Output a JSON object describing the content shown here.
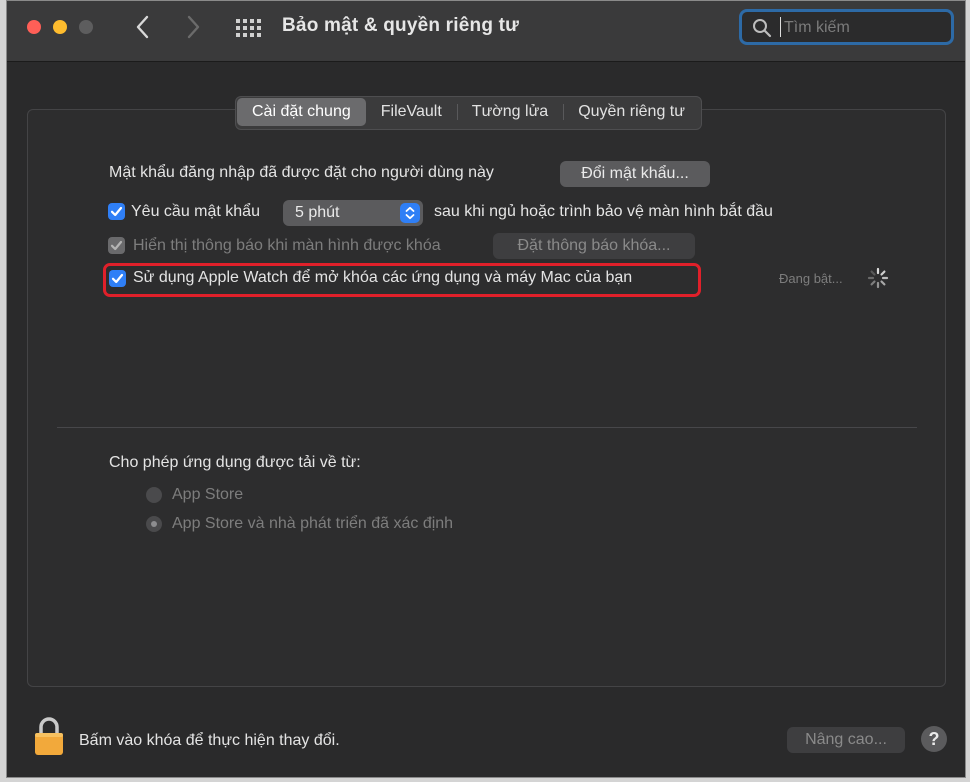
{
  "window": {
    "title": "Bảo mật & quyền riêng tư",
    "search_placeholder": "Tìm kiếm"
  },
  "tabs": [
    {
      "label": "Cài đặt chung",
      "active": true
    },
    {
      "label": "FileVault",
      "active": false
    },
    {
      "label": "Tường lửa",
      "active": false
    },
    {
      "label": "Quyền riêng tư",
      "active": false
    }
  ],
  "general": {
    "password_text": "Mật khẩu đăng nhập đã được đặt cho người dùng này",
    "change_password_button": "Đổi mật khẩu...",
    "require_password_label": "Yêu cầu mật khẩu",
    "require_password_checked": true,
    "delay_value": "5 phút",
    "after_sleep_text": "sau khi ngủ hoặc trình bảo vệ màn hình bắt đầu",
    "show_message_label": "Hiển thị thông báo khi màn hình được khóa",
    "show_message_checked": true,
    "set_message_button": "Đặt thông báo khóa...",
    "apple_watch_label": "Sử dụng Apple Watch để mở khóa các ứng dụng và máy Mac của bạn",
    "apple_watch_checked": true,
    "status_text": "Đang bật..."
  },
  "downloads": {
    "heading": "Cho phép ứng dụng được tải về từ:",
    "options": [
      {
        "label": "App Store",
        "selected": false
      },
      {
        "label": "App Store và nhà phát triển đã xác định",
        "selected": true
      }
    ]
  },
  "footer": {
    "lock_text": "Bấm vào khóa để thực hiện thay đổi.",
    "advanced_button": "Nâng cao...",
    "help_label": "?"
  },
  "colors": {
    "accent": "#2f7ff6",
    "highlight_border": "#e0202a",
    "search_focus": "#2d6aa6",
    "lock": "#f2a93b"
  },
  "icons": {
    "back": "chevron-left-icon",
    "forward": "chevron-right-icon",
    "grid": "grid-icon",
    "search": "search-icon",
    "spinner": "spinner-icon",
    "lock": "lock-icon"
  }
}
